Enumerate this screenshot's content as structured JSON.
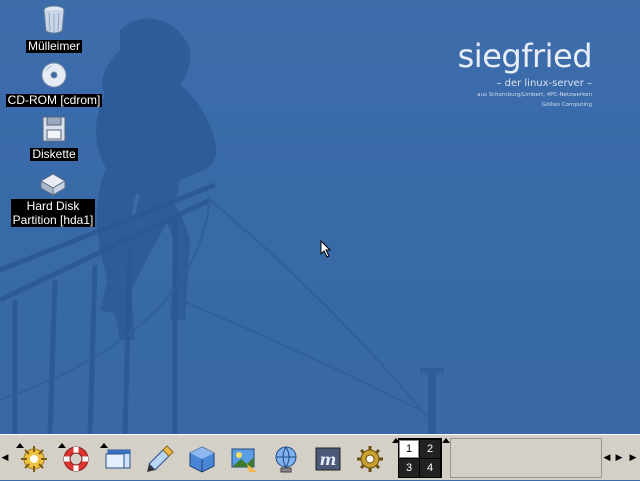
{
  "desktop": {
    "brand": {
      "name": "siegfried",
      "tagline": "– der linux-server –",
      "line1": "aus Schornburg/Limbert, 4PC-Netzwerken",
      "line2": "Göllies Computing"
    },
    "icons": [
      {
        "label": "Mülleimer",
        "icon": "trash-icon"
      },
      {
        "label": "CD-ROM [cdrom]",
        "icon": "cdrom-icon"
      },
      {
        "label": "Diskette",
        "icon": "floppy-icon"
      },
      {
        "label": "Hard Disk Partition [hda1]",
        "icon": "harddisk-icon",
        "label_line1": "Hard Disk",
        "label_line2": "Partition [hda1]"
      }
    ]
  },
  "panel": {
    "launchers": [
      "kde-menu-icon",
      "help-lifebuoy-icon",
      "window-list-icon",
      "text-editor-icon",
      "web-cube-icon",
      "image-viewer-icon",
      "network-globe-icon",
      "terminal-m-icon",
      "settings-gear-icon"
    ],
    "pager": {
      "desktops": [
        "1",
        "2",
        "3",
        "4"
      ],
      "active": "1"
    }
  },
  "colors": {
    "desktop_bg": "#3a6aa8",
    "panel_bg": "#d4d0c8",
    "label_bg": "#000000"
  }
}
